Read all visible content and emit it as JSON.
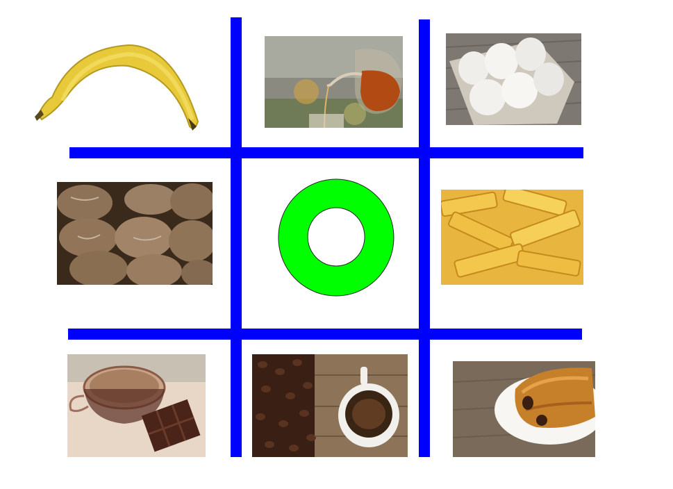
{
  "board": {
    "grid_color": "#0000ff",
    "cells": [
      {
        "row": 1,
        "col": 1,
        "image": "banana"
      },
      {
        "row": 1,
        "col": 2,
        "image": "tea-pouring"
      },
      {
        "row": 1,
        "col": 3,
        "image": "eggs-in-carton"
      },
      {
        "row": 2,
        "col": 1,
        "image": "bread-loaves"
      },
      {
        "row": 2,
        "col": 2,
        "mark": "O"
      },
      {
        "row": 2,
        "col": 3,
        "image": "penne-pasta"
      },
      {
        "row": 3,
        "col": 1,
        "image": "hot-chocolate"
      },
      {
        "row": 3,
        "col": 2,
        "image": "coffee-beans-cup"
      },
      {
        "row": 3,
        "col": 3,
        "image": "croissant"
      }
    ],
    "o_mark_color": "#00ff00"
  }
}
